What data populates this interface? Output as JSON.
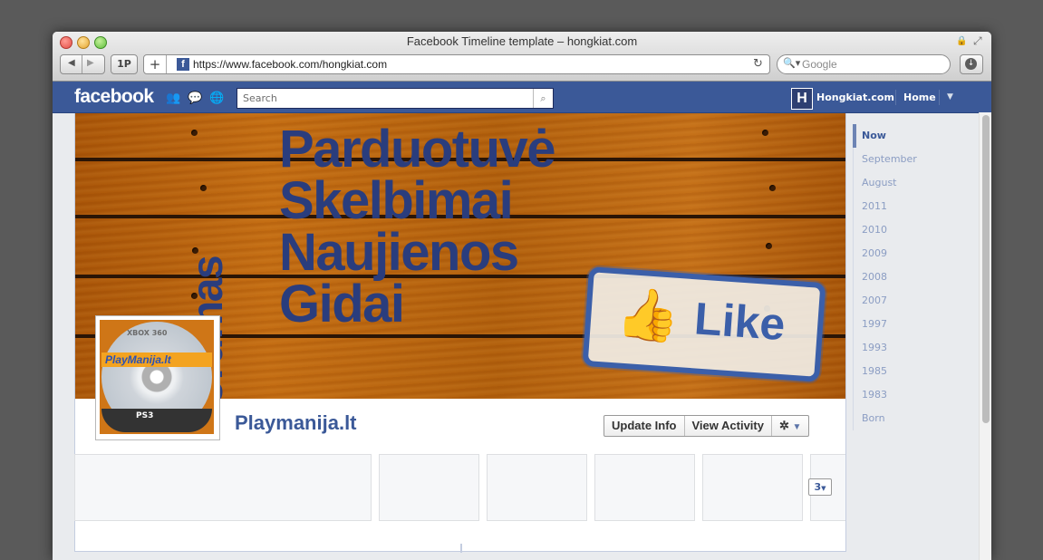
{
  "window": {
    "title": "Facebook Timeline template – hongkiat.com"
  },
  "toolbar": {
    "one_password_label": "1P",
    "new_tab_label": "+",
    "url": "https://www.facebook.com/hongkiat.com",
    "search_placeholder": "Google"
  },
  "fb_nav": {
    "logo_text": "facebook",
    "search_placeholder": "Search",
    "account_name": "Hongkiat.com",
    "account_icon_letter": "H",
    "home_label": "Home"
  },
  "cover": {
    "words": [
      "Parduotuvė",
      "Skelbimai",
      "Naujienos",
      "Gidai"
    ],
    "vertical_word": "Forumas",
    "like_stamp_text": "Like",
    "text_color": "#2a3d7d"
  },
  "profile": {
    "name": "Playmanija.lt",
    "picture": {
      "top_text": "XBOX 360",
      "logo_text": "PlayManija.lt",
      "bottom_text": "PS3"
    },
    "update_info_label": "Update Info",
    "view_activity_label": "View Activity",
    "settings_icon": "gear-icon",
    "more_tiles_count": "3"
  },
  "scrubber": {
    "items": [
      "Now",
      "September",
      "August",
      "2011",
      "2010",
      "2009",
      "2008",
      "2007",
      "1997",
      "1993",
      "1985",
      "1983",
      "Born"
    ],
    "active": "Now"
  },
  "colors": {
    "facebook_blue": "#3b5998",
    "cover_wood": "#c36c12"
  }
}
